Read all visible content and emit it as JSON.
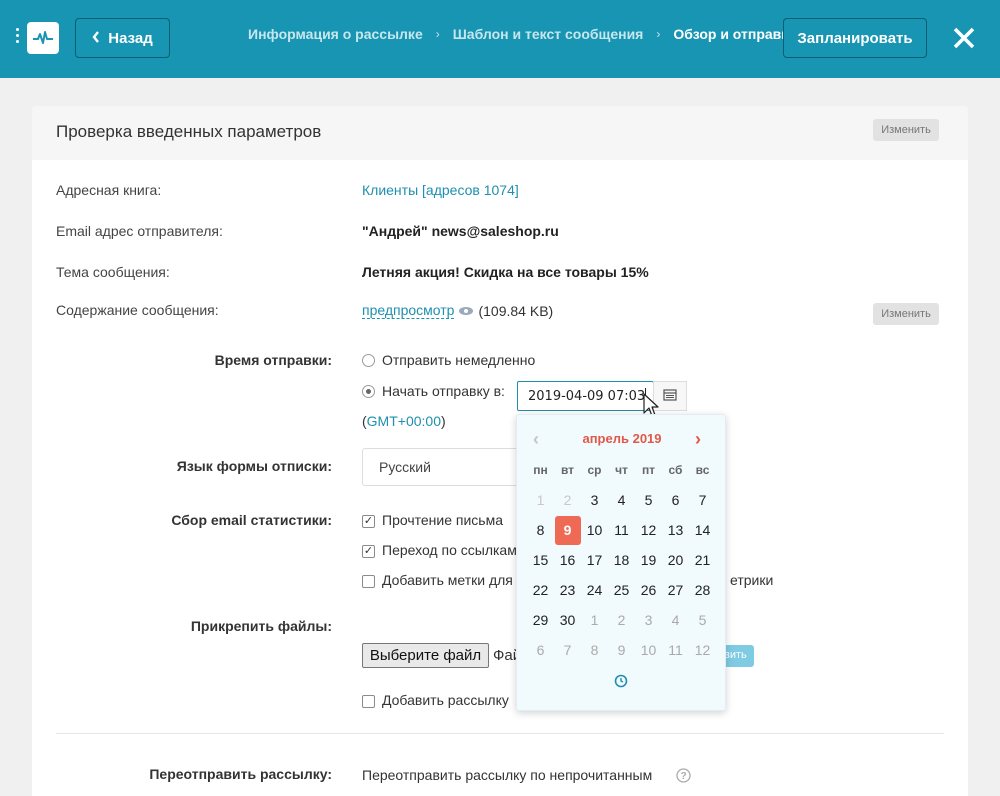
{
  "header": {
    "back_label": "Назад",
    "steps": [
      "Информация о рассылке",
      "Шаблон и текст сообщения",
      "Обзор и отправка"
    ],
    "schedule_label": "Запланировать",
    "brand_color": "#1795b3"
  },
  "card": {
    "title": "Проверка введенных параметров",
    "edit_label": "Изменить",
    "fields": {
      "address_book_label": "Адресная книга:",
      "address_book_value": "Клиенты [адресов 1074]",
      "sender_label": "Email адрес отправителя:",
      "sender_value": "\"Андрей\" news@saleshop.ru",
      "subject_label": "Тема сообщения:",
      "subject_value": "Летняя акция! Скидка на все товары 15%",
      "content_label": "Содержание сообщения:",
      "content_preview": "предпросмотр",
      "content_size": "(109.84 KB)",
      "content_edit_label": "Изменить"
    }
  },
  "send_time": {
    "label": "Время отправки:",
    "option_now": "Отправить немедленно",
    "option_schedule": "Начать отправку в:",
    "datetime_value": "2019-04-09 07:03",
    "timezone_prefix": "(",
    "timezone": "GMT+00:00",
    "timezone_suffix": ")"
  },
  "unsubscribe": {
    "label": "Язык формы отписки:",
    "value": "Русский"
  },
  "stats": {
    "label": "Сбор email статистики:",
    "opt1": "Прочтение письма",
    "opt2": "Переход по ссылкам",
    "opt3_left": "Добавить метки для",
    "opt3_right": "етрики"
  },
  "attach": {
    "label": "Прикрепить файлы:",
    "choose_label": "Выберите файл",
    "file_text": "Фай",
    "hidden_btn": "вить",
    "add_mailing_label": "Добавить рассылку"
  },
  "resend": {
    "label": "Переотправить рассылку:",
    "value": "Переотправить рассылку по непрочитанным"
  },
  "datepicker": {
    "month": "апрель 2019",
    "weekdays": [
      "пн",
      "вт",
      "ср",
      "чт",
      "пт",
      "сб",
      "вс"
    ],
    "weeks": [
      [
        "1",
        "2",
        "3",
        "4",
        "5",
        "6",
        "7"
      ],
      [
        "8",
        "9",
        "10",
        "11",
        "12",
        "13",
        "14"
      ],
      [
        "15",
        "16",
        "17",
        "18",
        "19",
        "20",
        "21"
      ],
      [
        "22",
        "23",
        "24",
        "25",
        "26",
        "27",
        "28"
      ],
      [
        "29",
        "30",
        "1",
        "2",
        "3",
        "4",
        "5"
      ],
      [
        "6",
        "7",
        "8",
        "9",
        "10",
        "11",
        "12"
      ]
    ],
    "selected": "9",
    "accent_color": "#ef6a55"
  }
}
